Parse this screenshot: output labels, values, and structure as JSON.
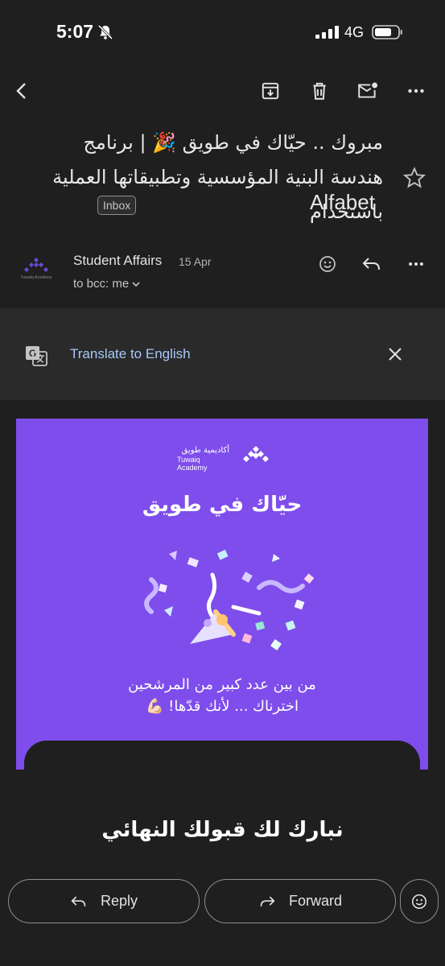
{
  "status_bar": {
    "time": "5:07",
    "network": "4G",
    "icons": [
      "bell-off-icon",
      "signal-icon",
      "battery-icon"
    ]
  },
  "toolbar": {
    "icons": [
      "back-icon",
      "archive-icon",
      "delete-icon",
      "mark-unread-icon",
      "more-icon"
    ]
  },
  "email": {
    "subject": "مبروك .. حيّاك في طويق 🎉 | برنامج هندسة البنية المؤسسية وتطبيقاتها العملية باستخدام",
    "subject_en": "Alfabet",
    "label": "Inbox"
  },
  "sender": {
    "name": "Student Affairs",
    "date": "15 Apr",
    "recipient": "to bcc: me",
    "avatar_text": "Tuwaiq Academy"
  },
  "translate": {
    "link": "Translate to English"
  },
  "body": {
    "logo_ar": "أكاديمية طويق",
    "logo_en": "Tuwaiq Academy",
    "title": "حيّاك في طويق",
    "line1": "من بين عدد كبير من المرشحين",
    "line2": "اخترناك ... لأنك قدّها! 💪🏻",
    "congrats": "نبارك لك قبولك النهائي"
  },
  "actions": {
    "reply": "Reply",
    "forward": "Forward"
  },
  "colors": {
    "background": "#1f1f1f",
    "brand_purple": "#7e4deb",
    "link": "#a8c7fa"
  }
}
